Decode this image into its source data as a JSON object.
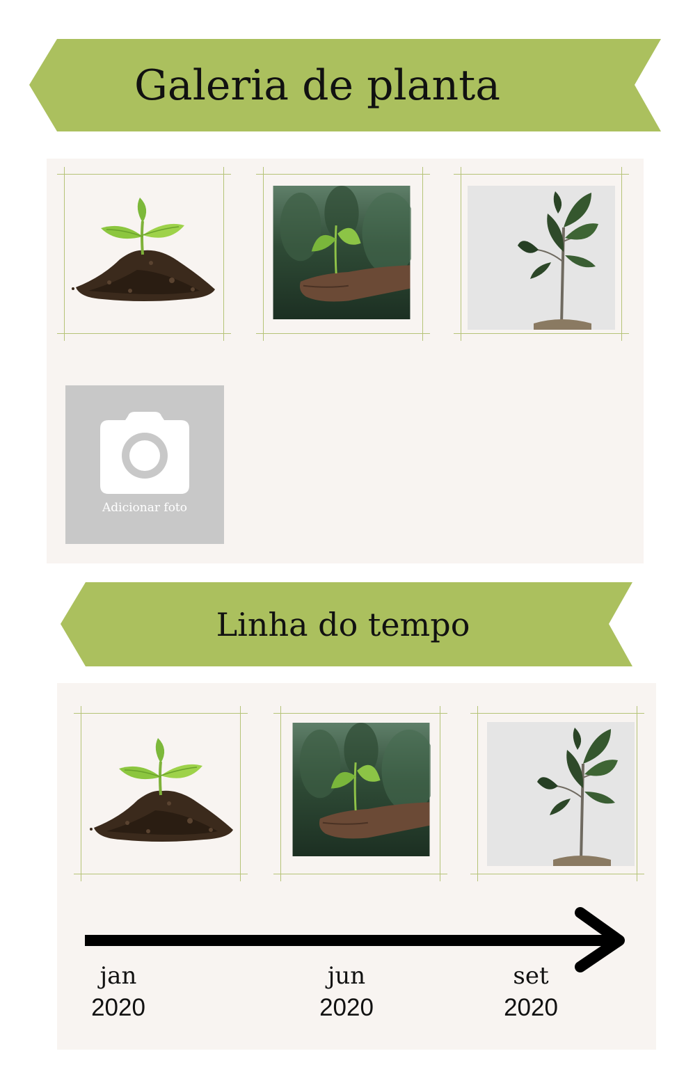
{
  "gallery": {
    "title": "Galeria de planta",
    "photos": [
      {
        "icon": "seedling-in-soil-photo"
      },
      {
        "icon": "seedling-in-hand-photo"
      },
      {
        "icon": "fiddle-leaf-tree-photo"
      }
    ],
    "add_photo_label": "Adicionar foto"
  },
  "timeline": {
    "title": "Linha do tempo",
    "photos": [
      {
        "icon": "seedling-in-soil-photo"
      },
      {
        "icon": "seedling-in-hand-photo"
      },
      {
        "icon": "fiddle-leaf-tree-photo"
      }
    ],
    "dates": [
      {
        "month": "jan",
        "year": "2020"
      },
      {
        "month": "jun",
        "year": "2020"
      },
      {
        "month": "set",
        "year": "2020"
      }
    ]
  },
  "colors": {
    "banner": "#abc05e",
    "panel": "#f8f4f1",
    "frame_line": "#b5c377",
    "placeholder": "#c8c8c8"
  }
}
